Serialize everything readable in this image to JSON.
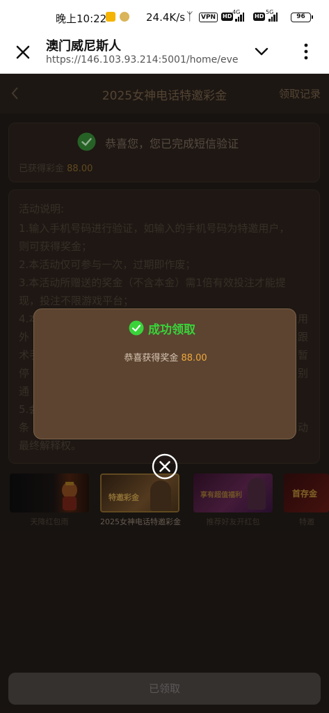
{
  "status_bar": {
    "time": "晚上10:22",
    "net_speed": "24.4K/s",
    "vpn": "VPN",
    "hd": "HD",
    "net_4g": "4G",
    "net_5g": "5G",
    "battery": "96"
  },
  "browser": {
    "title": "澳门威尼斯人",
    "url": "https://146.103.93.214:5001/home/eve"
  },
  "header": {
    "title": "2025女神电话特邀彩金",
    "records_link": "领取记录"
  },
  "verify": {
    "message": "恭喜您，您已完成短信验证",
    "bonus_label": "已获得彩金",
    "bonus_value": "88.00"
  },
  "rules": {
    "heading": "活动说明:",
    "lines": [
      "1.输入手机号码进行验证，如输入的手机号码为特邀用户，",
      "则可获得奖金；",
      "2.本活动仅可参与一次，过期即作废；",
      "3.本活动所赠送的奖金（不含本金）需1倍有效投注才能提",
      "现，投注不限游戏平台；",
      "4.本",
      "外",
      "术手",
      "停",
      "通",
      "5.会",
      "条",
      "最终解释权。"
    ],
    "tail_fragments": [
      "用",
      "跟",
      "暂",
      "别",
      "动"
    ]
  },
  "thumbnails": [
    {
      "label": "天降红包雨",
      "image_text": ""
    },
    {
      "label": "2025女神电话特邀彩金",
      "image_text": "特邀彩金"
    },
    {
      "label": "推荐好友开红包",
      "image_text": "享有超值福利"
    },
    {
      "label": "特邀",
      "image_text": "首存金"
    }
  ],
  "bottom_button": {
    "label": "已领取"
  },
  "modal": {
    "title": "成功领取",
    "body_prefix": "恭喜获得奖金",
    "amount": "88.00"
  },
  "colors": {
    "success_green": "#39d33a",
    "gold": "#f0a93c",
    "modal_bg": "#5c4431"
  }
}
